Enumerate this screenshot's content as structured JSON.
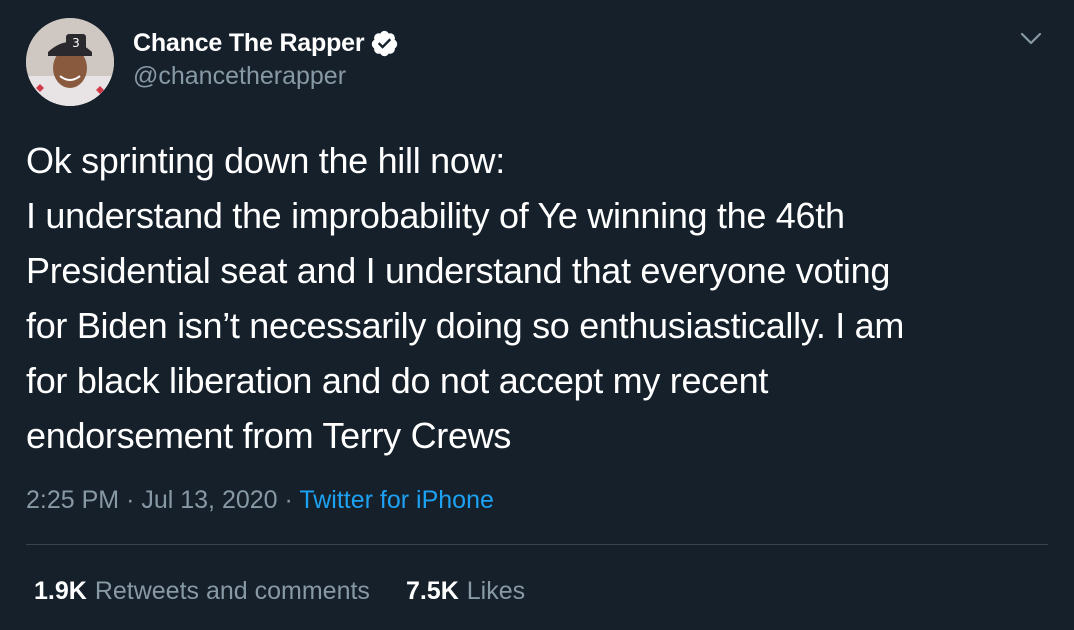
{
  "author": {
    "display_name": "Chance The Rapper",
    "handle": "@chancetherapper",
    "verified": true
  },
  "tweet": {
    "lines": [
      "Ok sprinting down the hill now:",
      "I understand the improbability of Ye winning the 46th",
      "Presidential seat and I understand that everyone voting",
      "for Biden isn’t necessarily doing so enthusiastically. I am",
      "for black liberation and do not accept my recent",
      "endorsement from Terry Crews"
    ]
  },
  "meta": {
    "time": "2:25 PM",
    "separator": "·",
    "date": "Jul 13, 2020",
    "source": "Twitter for iPhone"
  },
  "stats": {
    "retweets_count": "1.9K",
    "retweets_label": "Retweets and comments",
    "likes_count": "7.5K",
    "likes_label": "Likes"
  },
  "colors": {
    "background": "#15202b",
    "text": "#ffffff",
    "muted": "#8899a6",
    "link": "#1da1f2",
    "divider": "#38444d"
  },
  "icons": {
    "verified": "verified-badge-icon",
    "caret": "chevron-down-icon"
  }
}
